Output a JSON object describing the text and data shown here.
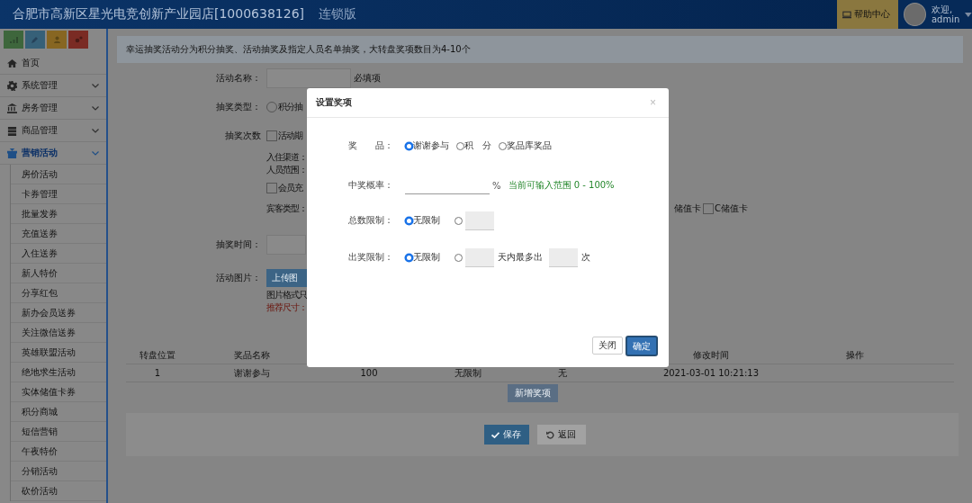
{
  "header": {
    "title": "合肥市高新区星光电竞创新产业园店[1000638126]",
    "edition": "连锁版",
    "help_button": "帮助中心",
    "user": {
      "greeting": "欢迎,",
      "name": "admin"
    }
  },
  "sidebar": {
    "items": [
      {
        "label": "首页",
        "kind": "link",
        "selected": false
      },
      {
        "label": "系统管理",
        "kind": "group",
        "selected": false
      },
      {
        "label": "房务管理",
        "kind": "group",
        "selected": false
      },
      {
        "label": "商品管理",
        "kind": "group",
        "selected": false
      },
      {
        "label": "营销活动",
        "kind": "group",
        "selected": true,
        "children": [
          {
            "label": "房价活动"
          },
          {
            "label": "卡券管理"
          },
          {
            "label": "批量发券"
          },
          {
            "label": "充值送券"
          },
          {
            "label": "入住送券"
          },
          {
            "label": "新人特价"
          },
          {
            "label": "分享红包"
          },
          {
            "label": "新办会员送券"
          },
          {
            "label": "关注微信送券"
          },
          {
            "label": "英雄联盟活动"
          },
          {
            "label": "绝地求生活动"
          },
          {
            "label": "实体储值卡券"
          },
          {
            "label": "积分商城"
          },
          {
            "label": "短信营销"
          },
          {
            "label": "午夜特价"
          },
          {
            "label": "分销活动"
          },
          {
            "label": "砍价活动"
          }
        ]
      }
    ]
  },
  "notice": "幸运抽奖活动分为积分抽奖、活动抽奖及指定人员名单抽奖，大转盘奖项数目为4-10个",
  "form": {
    "name": {
      "label": "活动名称：",
      "hint": "必填项"
    },
    "type": {
      "label": "抽奖类型：",
      "option": "积分抽",
      "selected": false
    },
    "count": {
      "label": "抽奖次数",
      "option": "活动期",
      "checked": false,
      "channel": "入住渠道：",
      "scope": "人员范围：",
      "member_option": "会员充",
      "member_checked": false,
      "guest": "宾客类型：",
      "guest_options": [
        {
          "label": "储值卡"
        },
        {
          "label": "C储值卡",
          "checked": false
        }
      ]
    },
    "time": {
      "label": "抽奖时间："
    },
    "image": {
      "label": "活动图片：",
      "upload": "上传图",
      "format_note": "图片格式只",
      "size_note": "推荐尺寸："
    }
  },
  "table": {
    "columns": [
      {
        "label": "转盘位置"
      },
      {
        "label": "奖品名称"
      },
      {},
      {},
      {},
      {
        "label": "修改时间"
      },
      {
        "label": "操作"
      }
    ],
    "rows": [
      [
        "1",
        "谢谢参与",
        "100",
        "无限制",
        "无",
        "2021-03-01 10:21:13"
      ]
    ]
  },
  "add_button": "新增奖项",
  "footer": {
    "save": "保存",
    "back": "返回"
  },
  "modal": {
    "title": "设置奖项",
    "close": "×",
    "prize": {
      "label": "奖　　品：",
      "options": [
        {
          "label": "谢谢参与",
          "selected": true
        },
        {
          "label": "积　分",
          "selected": false
        },
        {
          "label": "奖品库奖品",
          "selected": false
        }
      ]
    },
    "probability": {
      "label": "中奖概率：",
      "suffix": "%",
      "hint": "当前可输入范围 0 - 100%"
    },
    "total_limit": {
      "label": "总数限制：",
      "unlimited": {
        "label": "无限制",
        "selected": true
      },
      "custom": {
        "selected": false
      }
    },
    "draw_limit": {
      "label": "出奖限制：",
      "unlimited": {
        "label": "无限制",
        "selected": true
      },
      "custom": {
        "selected": false,
        "middle": "天内最多出",
        "unit": "次"
      }
    },
    "buttons": {
      "cancel": "关闭",
      "ok": "确定"
    }
  }
}
